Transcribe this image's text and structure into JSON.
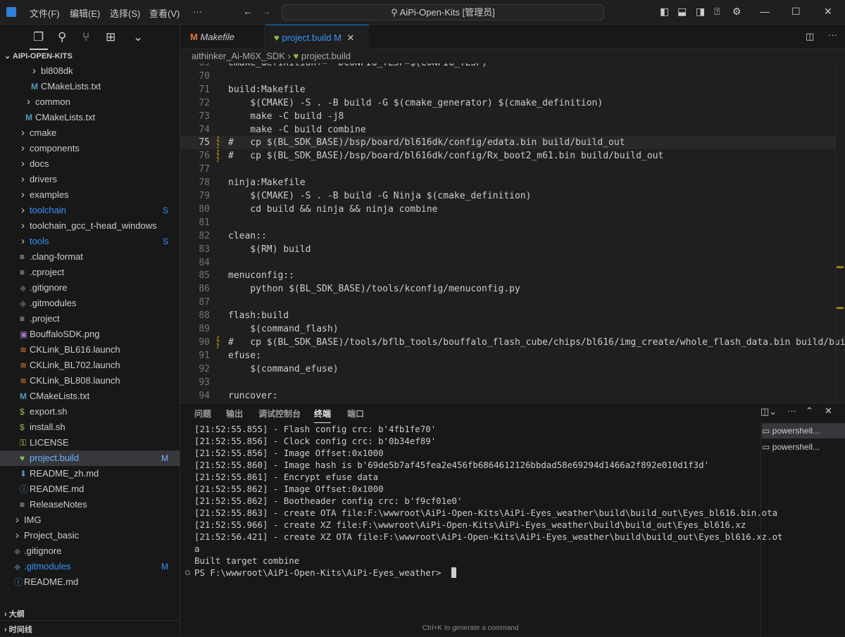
{
  "titlebar": {
    "menus": [
      "文件(F)",
      "编辑(E)",
      "选择(S)",
      "查看(V)",
      "···"
    ],
    "search": "AiPi-Open-Kits [管理员]"
  },
  "explorer": {
    "root": "AIPI-OPEN-KITS",
    "items": [
      {
        "label": "bl808dk",
        "depth": 3,
        "type": "folder"
      },
      {
        "label": "CMakeLists.txt",
        "depth": 3,
        "type": "cmake"
      },
      {
        "label": "common",
        "depth": 2,
        "type": "folder"
      },
      {
        "label": "CMakeLists.txt",
        "depth": 2,
        "type": "cmake"
      },
      {
        "label": "cmake",
        "depth": 1,
        "type": "folder"
      },
      {
        "label": "components",
        "depth": 1,
        "type": "folder"
      },
      {
        "label": "docs",
        "depth": 1,
        "type": "folder"
      },
      {
        "label": "drivers",
        "depth": 1,
        "type": "folder"
      },
      {
        "label": "examples",
        "depth": 1,
        "type": "folder"
      },
      {
        "label": "toolchain",
        "depth": 1,
        "type": "folder",
        "badge": "S",
        "color": "#3794ff"
      },
      {
        "label": "toolchain_gcc_t-head_windows",
        "depth": 1,
        "type": "folder"
      },
      {
        "label": "tools",
        "depth": 1,
        "type": "folder",
        "badge": "S",
        "color": "#3794ff"
      },
      {
        "label": ".clang-format",
        "depth": 1,
        "type": "lines"
      },
      {
        "label": ".cproject",
        "depth": 1,
        "type": "lines"
      },
      {
        "label": ".gitignore",
        "depth": 1,
        "type": "git"
      },
      {
        "label": ".gitmodules",
        "depth": 1,
        "type": "git"
      },
      {
        "label": ".project",
        "depth": 1,
        "type": "lines"
      },
      {
        "label": "BouffaloSDK.png",
        "depth": 1,
        "type": "image"
      },
      {
        "label": "CKLink_BL616.launch",
        "depth": 1,
        "type": "rss"
      },
      {
        "label": "CKLink_BL702.launch",
        "depth": 1,
        "type": "rss"
      },
      {
        "label": "CKLink_BL808.launch",
        "depth": 1,
        "type": "rss"
      },
      {
        "label": "CMakeLists.txt",
        "depth": 1,
        "type": "cmake"
      },
      {
        "label": "export.sh",
        "depth": 1,
        "type": "shell"
      },
      {
        "label": "install.sh",
        "depth": 1,
        "type": "shell"
      },
      {
        "label": "LICENSE",
        "depth": 1,
        "type": "license"
      },
      {
        "label": "project.build",
        "depth": 1,
        "type": "heart",
        "badge": "M",
        "color": "#6cb6ff",
        "selected": true
      },
      {
        "label": "README_zh.md",
        "depth": 1,
        "type": "download"
      },
      {
        "label": "README.md",
        "depth": 1,
        "type": "info"
      },
      {
        "label": "ReleaseNotes",
        "depth": 1,
        "type": "lines"
      },
      {
        "label": "IMG",
        "depth": 0,
        "type": "folder"
      },
      {
        "label": "Project_basic",
        "depth": 0,
        "type": "folder"
      },
      {
        "label": ".gitignore",
        "depth": 0,
        "type": "git"
      },
      {
        "label": ".gitmodules",
        "depth": 0,
        "type": "git",
        "badge": "M",
        "color": "#3794ff"
      },
      {
        "label": "README.md",
        "depth": 0,
        "type": "info"
      }
    ],
    "outline": "大纲",
    "timeline": "时间线"
  },
  "tabs": [
    {
      "label": "Makefile",
      "icon": "M"
    },
    {
      "label": "project.build",
      "badge": "M",
      "active": true
    }
  ],
  "breadcrumb": [
    "aithinker_Ai-M6X_SDK",
    "project.build"
  ],
  "editor": {
    "lines": [
      {
        "n": 69,
        "t": "cmake_definition+= -DCONFIG_TLSF=$(CONFIG_TLSF)"
      },
      {
        "n": 70,
        "t": ""
      },
      {
        "n": 71,
        "t": "build:Makefile"
      },
      {
        "n": 72,
        "t": "    $(CMAKE) -S . -B build -G $(cmake_generator) $(cmake_definition)"
      },
      {
        "n": 73,
        "t": "    make -C build -j8"
      },
      {
        "n": 74,
        "t": "    make -C build combine"
      },
      {
        "n": 75,
        "t": "#   cp $(BL_SDK_BASE)/bsp/board/bl616dk/config/edata.bin build/build_out",
        "mod": true,
        "cur": true
      },
      {
        "n": 76,
        "t": "#   cp $(BL_SDK_BASE)/bsp/board/bl616dk/config/Rx_boot2_m61.bin build/build_out",
        "mod": true
      },
      {
        "n": 77,
        "t": ""
      },
      {
        "n": 78,
        "t": "ninja:Makefile"
      },
      {
        "n": 79,
        "t": "    $(CMAKE) -S . -B build -G Ninja $(cmake_definition)"
      },
      {
        "n": 80,
        "t": "    cd build && ninja && ninja combine"
      },
      {
        "n": 81,
        "t": ""
      },
      {
        "n": 82,
        "t": "clean::"
      },
      {
        "n": 83,
        "t": "    $(RM) build"
      },
      {
        "n": 84,
        "t": ""
      },
      {
        "n": 85,
        "t": "menuconfig::"
      },
      {
        "n": 86,
        "t": "    python $(BL_SDK_BASE)/tools/kconfig/menuconfig.py"
      },
      {
        "n": 87,
        "t": ""
      },
      {
        "n": 88,
        "t": "flash:build"
      },
      {
        "n": 89,
        "t": "    $(command_flash)"
      },
      {
        "n": 90,
        "t": "#   cp $(BL_SDK_BASE)/tools/bflb_tools/bouffalo_flash_cube/chips/bl616/img_create/whole_flash_data.bin build/build_out",
        "mod": true
      },
      {
        "n": 91,
        "t": "efuse:"
      },
      {
        "n": 92,
        "t": "    $(command_efuse)"
      },
      {
        "n": 93,
        "t": ""
      },
      {
        "n": 94,
        "t": "runcover:"
      }
    ]
  },
  "panel": {
    "tabs": [
      "问题",
      "输出",
      "调试控制台",
      "终端",
      "端口"
    ],
    "active": 3,
    "terminal": [
      "[21:52:55.855] - Flash config crc: b'4fb1fe70'",
      "[21:52:55.856] - Clock config crc: b'0b34ef89'",
      "[21:52:55.856] - Image Offset:0x1000",
      "[21:52:55.860] - Image hash is b'69de5b7af45fea2e456fb6864612126bbdad58e69294d1466a2f892e010d1f3d'",
      "[21:52:55.861] - Encrypt efuse data",
      "[21:52:55.862] - Image Offset:0x1000",
      "[21:52:55.862] - Bootheader config crc: b'f9cf01e0'",
      "[21:52:55.863] - create OTA file:F:\\wwwroot\\AiPi-Open-Kits\\AiPi-Eyes_weather\\build\\build_out\\Eyes_bl616.bin.ota",
      "[21:52:55.966] - create XZ file:F:\\wwwroot\\AiPi-Open-Kits\\AiPi-Eyes_weather\\build\\build_out\\Eyes_bl616.xz",
      "[21:52:56.421] - create XZ OTA file:F:\\wwwroot\\AiPi-Open-Kits\\AiPi-Eyes_weather\\build\\build_out\\Eyes_bl616.xz.ot",
      "a",
      "Built target combine",
      "PS F:\\wwwroot\\AiPi-Open-Kits\\AiPi-Eyes_weather> "
    ],
    "terminals": [
      "powershell...",
      "powershell..."
    ],
    "hint": "Ctrl+K to generate a command"
  }
}
